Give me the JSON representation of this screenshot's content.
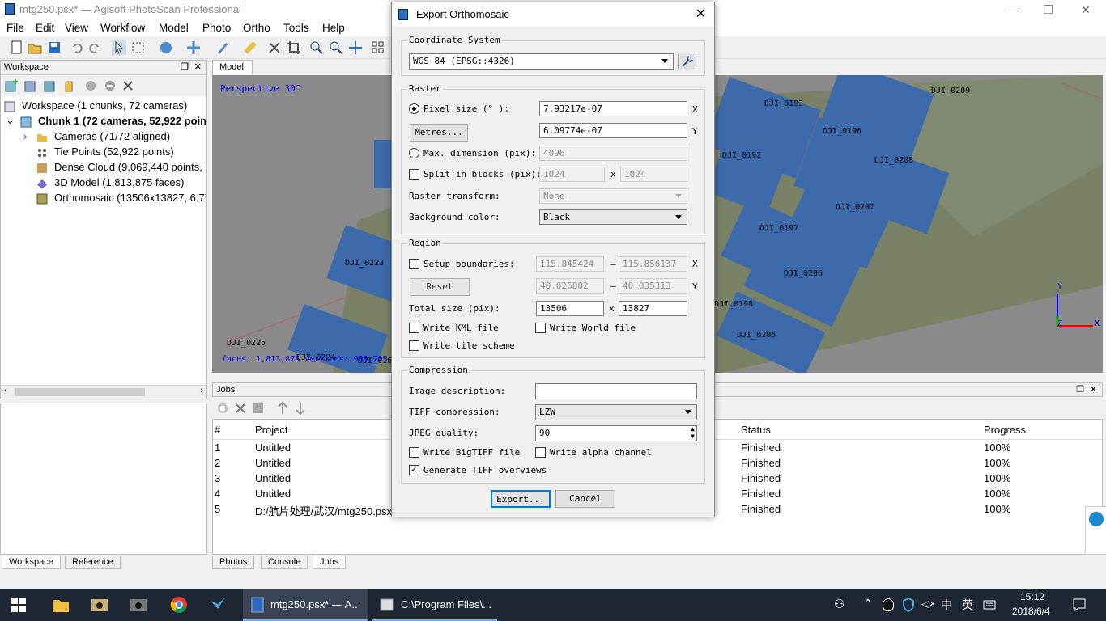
{
  "window": {
    "title": "mtg250.psx* — Agisoft PhotoScan Professional"
  },
  "menu": [
    "File",
    "Edit",
    "View",
    "Workflow",
    "Model",
    "Photo",
    "Ortho",
    "Tools",
    "Help"
  ],
  "workspace": {
    "header": "Workspace",
    "items": [
      "Workspace (1 chunks, 72 cameras)",
      "Chunk 1 (72 cameras, 52,922 points",
      "Cameras (71/72 aligned)",
      "Tie Points (52,922 points)",
      "Dense Cloud (9,069,440 points, M",
      "3D Model (1,813,875 faces)",
      "Orthomosaic (13506x13827, 6.77"
    ]
  },
  "model": {
    "tab": "Model",
    "perspective": "Perspective 30°",
    "faces_text": "faces: 1,813,875 vertices: 909,703",
    "cameras": [
      "DJI_0193",
      "DJI_0209",
      "DJI_0196",
      "DJI_0192",
      "DJI_0208",
      "DJI_0207",
      "DJI_0197",
      "DJI_0223",
      "DJI_0206",
      "DJI_0198",
      "DJI_0205",
      "DJI_0225",
      "DJI_0224",
      "DJI_016"
    ],
    "axis": {
      "y": "Y",
      "x": "X",
      "z": "Z"
    }
  },
  "jobs": {
    "header": "Jobs",
    "columns": [
      "#",
      "Project",
      "Status",
      "Progress"
    ],
    "rows": [
      {
        "n": "1",
        "project": "Untitled",
        "status": "Finished",
        "progress": "100%"
      },
      {
        "n": "2",
        "project": "Untitled",
        "status": "Finished",
        "progress": "100%"
      },
      {
        "n": "3",
        "project": "Untitled",
        "status": "Finished",
        "progress": "100%"
      },
      {
        "n": "4",
        "project": "Untitled",
        "status": "Finished",
        "progress": "100%"
      },
      {
        "n": "5",
        "project": "D:/航片处理/武汉/mtg250.psx",
        "status": "Finished",
        "progress": "100%"
      }
    ]
  },
  "bottom_tabs_left": [
    "Workspace",
    "Reference"
  ],
  "bottom_tabs_right": [
    "Photos",
    "Console",
    "Jobs"
  ],
  "dialog": {
    "title": "Export Orthomosaic",
    "coord_group": "Coordinate System",
    "coord_value": "WGS 84 (EPSG::4326)",
    "raster_group": "Raster",
    "pixel_size_label": "Pixel size (° ):",
    "pixel_x": "7.93217e-07",
    "pixel_y": "6.09774e-07",
    "metres_btn": "Metres...",
    "max_dim_label": "Max. dimension (pix):",
    "max_dim_value": "4096",
    "split_label": "Split in blocks (pix):",
    "split_w": "1024",
    "split_h": "1024",
    "raster_transform_label": "Raster transform:",
    "raster_transform_value": "None",
    "bg_color_label": "Background color:",
    "bg_color_value": "Black",
    "region_group": "Region",
    "setup_label": "Setup boundaries:",
    "x_min": "115.845424",
    "x_max": "115.856137",
    "y_min": "40.026882",
    "y_max": "40.035313",
    "reset_btn": "Reset",
    "total_label": "Total size (pix):",
    "total_w": "13506",
    "total_h": "13827",
    "kml_label": "Write KML file",
    "world_label": "Write World file",
    "tile_label": "Write tile scheme",
    "compression_group": "Compression",
    "image_desc_label": "Image description:",
    "image_desc_value": "",
    "tiff_comp_label": "TIFF compression:",
    "tiff_comp_value": "LZW",
    "jpeg_label": "JPEG quality:",
    "jpeg_value": "90",
    "bigtiff_label": "Write BigTIFF file",
    "alpha_label": "Write alpha channel",
    "overviews_label": "Generate TIFF overviews",
    "export_btn": "Export...",
    "cancel_btn": "Cancel",
    "x_marker": "X",
    "y_marker": "Y",
    "dash": "–",
    "times": "x"
  },
  "taskbar": {
    "app1": "mtg250.psx* — A...",
    "app2": "C:\\Program Files\\...",
    "ime": "英",
    "time": "15:12",
    "date": "2018/6/4"
  }
}
